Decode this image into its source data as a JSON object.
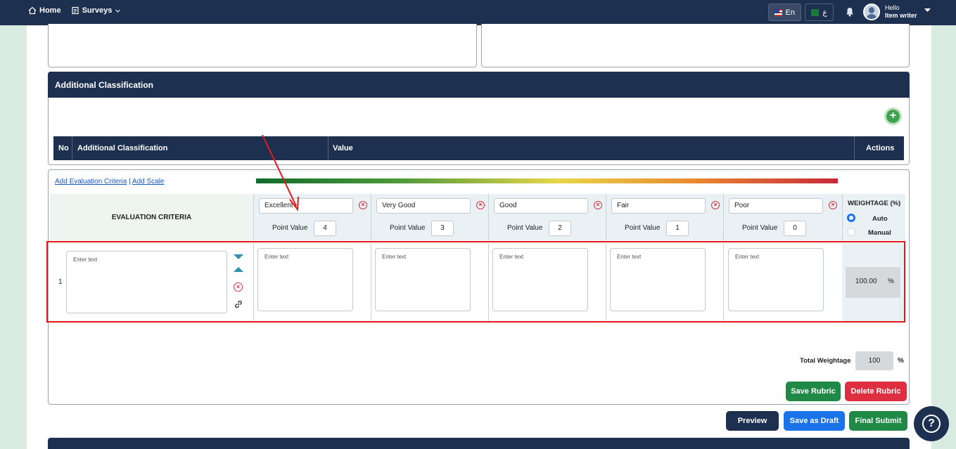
{
  "nav": {
    "home": "Home",
    "surveys": "Surveys"
  },
  "lang": {
    "en": "En",
    "ar": "ع"
  },
  "user": {
    "greeting": "Hello",
    "role": "Item writer"
  },
  "panel": {
    "title": "Additional Classification"
  },
  "classification_table": {
    "headers": [
      "No",
      "Additional Classification",
      "Value",
      "Actions"
    ]
  },
  "links": {
    "add_criteria": "Add Evaluation Criteria",
    "separator": "|",
    "add_scale": "Add Scale"
  },
  "rubric": {
    "criteria_header": "EVALUATION CRITERIA",
    "point_label": "Point Value",
    "scales": [
      {
        "name": "Excellent",
        "points": "4"
      },
      {
        "name": "Very Good",
        "points": "3"
      },
      {
        "name": "Good",
        "points": "2"
      },
      {
        "name": "Fair",
        "points": "1"
      },
      {
        "name": "Poor",
        "points": "0"
      }
    ],
    "weightage_header": "WEIGHTAGE (%)",
    "auto_label": "Auto",
    "manual_label": "Manual",
    "rows": [
      {
        "no": "1",
        "criteria_placeholder": "Enter text",
        "cell_placeholder": "Enter text",
        "weight": "100.00",
        "weight_unit": "%"
      }
    ]
  },
  "totals": {
    "label": "Total Weightage",
    "value": "100",
    "unit": "%"
  },
  "buttons": {
    "save_rubric": "Save Rubric",
    "delete_rubric": "Delete Rubric",
    "preview": "Preview",
    "save_draft": "Save as Draft",
    "final_submit": "Final Submit"
  },
  "colors": {
    "navy": "#1e3050",
    "green": "#1f8a45",
    "red": "#de2f40",
    "blue": "#1a73e8"
  }
}
